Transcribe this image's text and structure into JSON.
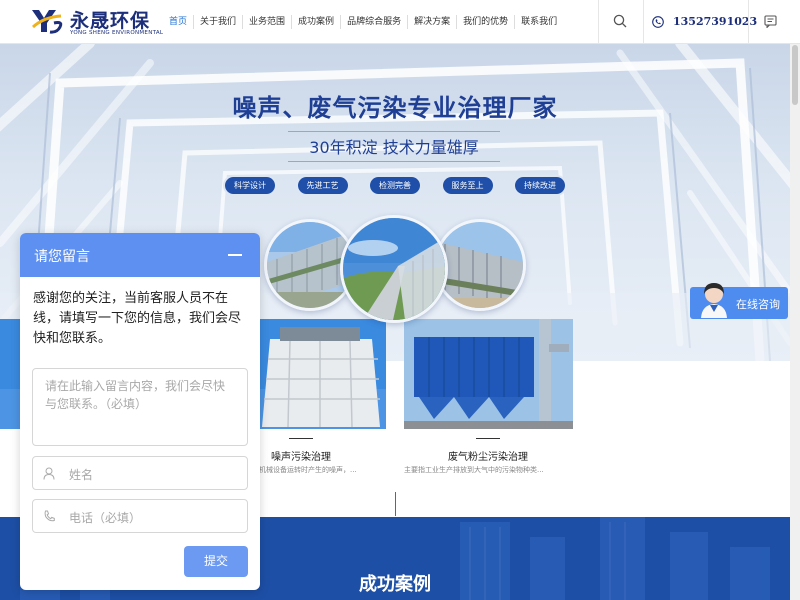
{
  "header": {
    "logo_cn": "永晟环保",
    "logo_en": "YONG SHENG ENVIRONMENTAL",
    "nav": [
      "首页",
      "关于我们",
      "业务范围",
      "成功案例",
      "品牌综合服务",
      "解决方案",
      "我们的优势",
      "联系我们"
    ],
    "phone": "13527391023"
  },
  "hero": {
    "title": "噪声、废气污染专业治理厂家",
    "subtitle": "30年积淀  技术力量雄厚",
    "tags": [
      "科学设计",
      "先进工艺",
      "检测完善",
      "服务至上",
      "持续改进"
    ]
  },
  "consult": {
    "label": "在线咨询"
  },
  "products": [
    {
      "title": "噪声污染治理",
      "desc": "指机械设备运转时产生的噪声，..."
    },
    {
      "title": "废气粉尘污染治理",
      "desc": "主要指工业生产排放到大气中的污染物种类..."
    }
  ],
  "cases": {
    "title": "成功案例"
  },
  "message_panel": {
    "title": "请您留言",
    "intro": "感谢您的关注，当前客服人员不在线，请填写一下您的信息，我们会尽快和您联系。",
    "textarea_placeholder": "请在此输入留言内容，我们会尽快与您联系。（必填）",
    "name_placeholder": "姓名",
    "phone_placeholder": "电话（必填）",
    "submit_label": "提交"
  },
  "colors": {
    "brand": "#1f4fa8",
    "panel_header": "#5e90f2",
    "consult": "#4e8cf0"
  }
}
